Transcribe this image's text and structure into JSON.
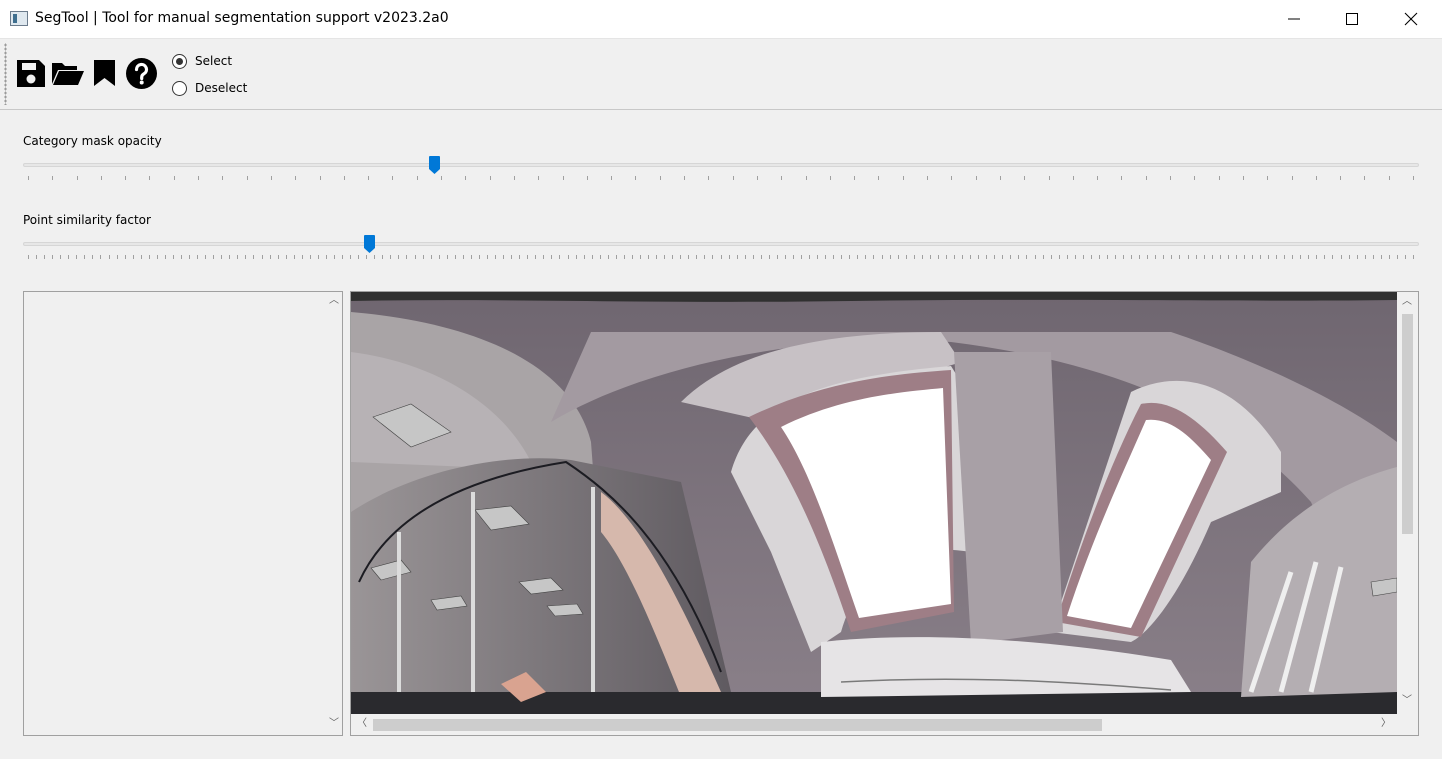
{
  "window": {
    "title": "SegTool | Tool for manual segmentation support v2023.2a0",
    "app_icon": "app-window-icon",
    "controls": [
      "minimize-icon",
      "maximize-icon",
      "close-icon"
    ]
  },
  "toolbar": {
    "tools": [
      "save-icon",
      "folder-open-icon",
      "bookmark-icon",
      "help-icon"
    ],
    "mode": {
      "options": [
        {
          "label": "Select",
          "checked": true
        },
        {
          "label": "Deselect",
          "checked": false
        }
      ]
    }
  },
  "sliders": {
    "opacity": {
      "label": "Category mask opacity",
      "position_fraction": 0.295,
      "tick_count": 58
    },
    "similarity": {
      "label": "Point similarity factor",
      "position_fraction": 0.248,
      "tick_count": 173
    }
  },
  "colors": {
    "accent": "#0078d7",
    "scene_wall": "#7c7078",
    "window_light": "#ffffff",
    "frame": "#9e7e86"
  }
}
